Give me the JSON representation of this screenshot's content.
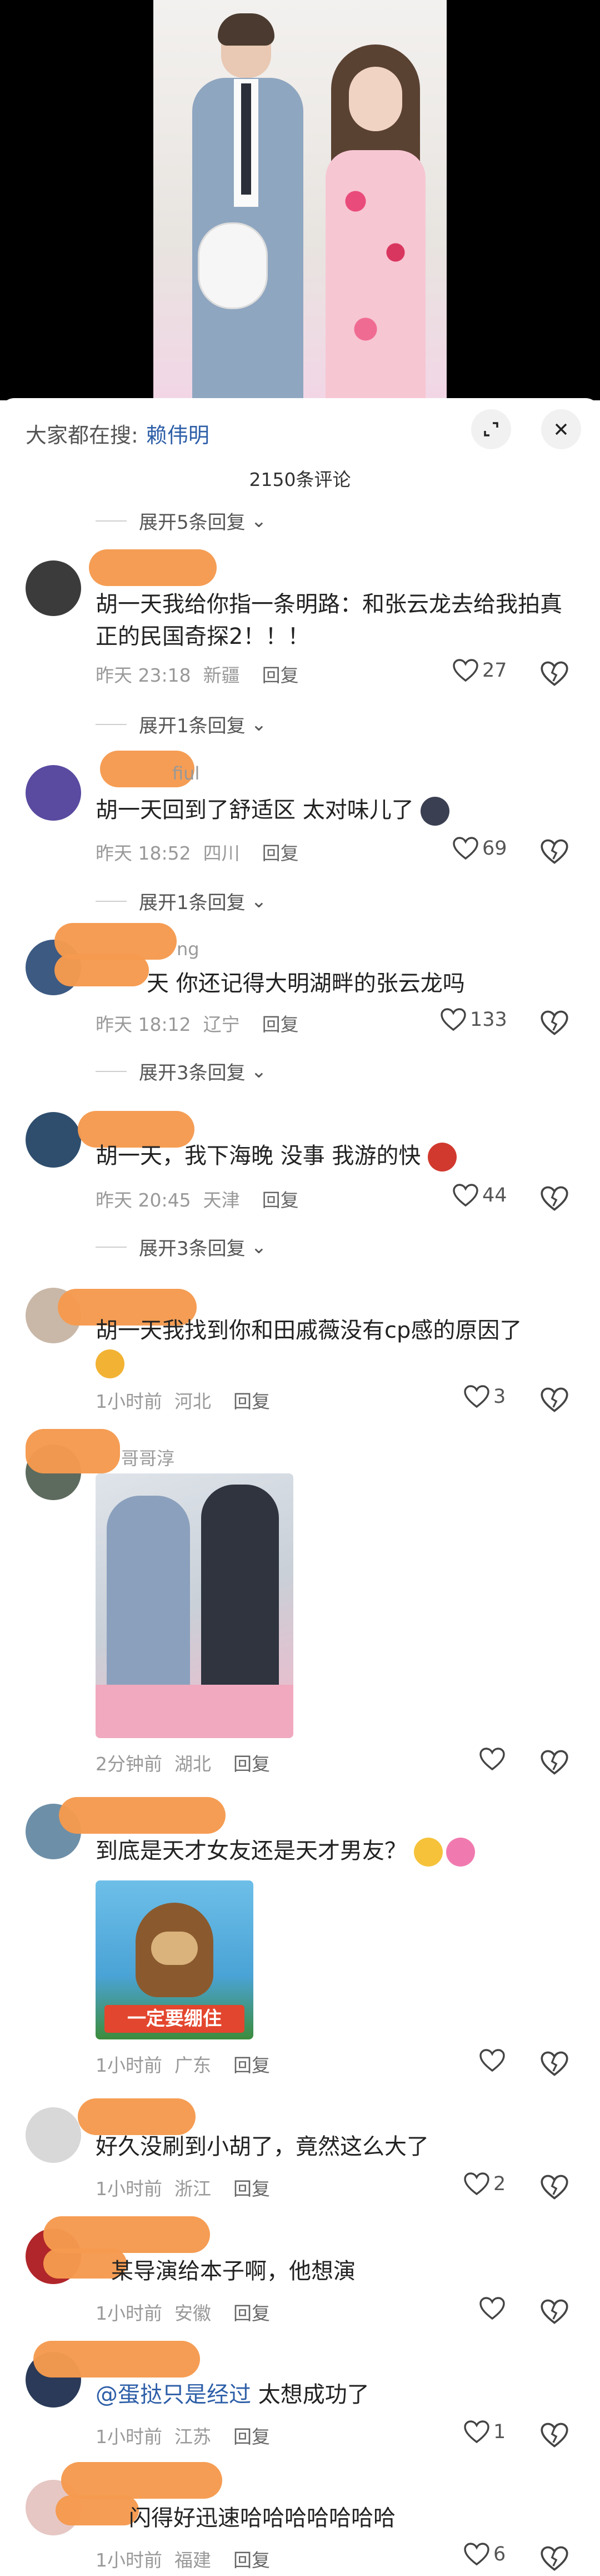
{
  "sheet": {
    "search_prefix": "大家都在搜:",
    "search_keyword": "赖伟明",
    "comment_count": "2150条评论"
  },
  "colors": {
    "accent_blue": "#2e5fa8",
    "redaction": "#f59a4e"
  },
  "icons": {
    "minimize": "collapse-icon",
    "close": "close-icon",
    "heart": "heart-icon",
    "dislike": "broken-heart-icon"
  },
  "comments": [
    {
      "expand_label": "展开5条回复",
      "username": "",
      "text": "胡一天我给你指一条明路：和张云龙去给我拍真正的民国奇探2！！！",
      "time": "昨天 23:18",
      "location": "新疆",
      "reply": "回复",
      "likes": "27"
    },
    {
      "expand_label": "展开1条回复",
      "username": "fiul",
      "text": "胡一天回到了舒适区 太对味儿了",
      "time": "昨天 18:52",
      "location": "四川",
      "reply": "回复",
      "likes": "69"
    },
    {
      "expand_label": "展开1条回复",
      "username": "ng",
      "text": "天 你还记得大明湖畔的张云龙吗",
      "time": "昨天 18:12",
      "location": "辽宁",
      "reply": "回复",
      "likes": "133"
    },
    {
      "expand_label": "展开3条回复",
      "username": "",
      "text": "胡一天，我下海晚 没事 我游的快",
      "time": "昨天 20:45",
      "location": "天津",
      "reply": "回复",
      "likes": "44"
    },
    {
      "expand_label": "展开3条回复",
      "username": "",
      "text": "胡一天我找到你和田戚薇没有cp感的原因了",
      "time": "1小时前",
      "location": "河北",
      "reply": "回复",
      "likes": "3"
    },
    {
      "username": "哥哥淳",
      "text": "",
      "time": "2分钟前",
      "location": "湖北",
      "reply": "回复",
      "likes": ""
    },
    {
      "username": "",
      "text": "到底是天才女友还是天才男友？",
      "sticker": "一定要绷住",
      "time": "1小时前",
      "location": "广东",
      "reply": "回复",
      "likes": ""
    },
    {
      "username": "",
      "text": "好久没刷到小胡了，竟然这么大了",
      "time": "1小时前",
      "location": "浙江",
      "reply": "回复",
      "likes": "2"
    },
    {
      "username": "",
      "text": "某导演给本子啊，他想演",
      "time": "1小时前",
      "location": "安徽",
      "reply": "回复",
      "likes": ""
    },
    {
      "username": "",
      "mention": "@蛋挞只是经过",
      "text": " 太想成功了",
      "time": "1小时前",
      "location": "江苏",
      "reply": "回复",
      "likes": "1"
    },
    {
      "username": "",
      "text": "闪得好迅速哈哈哈哈哈哈哈",
      "time": "1小时前",
      "location": "福建",
      "reply": "回复",
      "likes": "6"
    }
  ]
}
